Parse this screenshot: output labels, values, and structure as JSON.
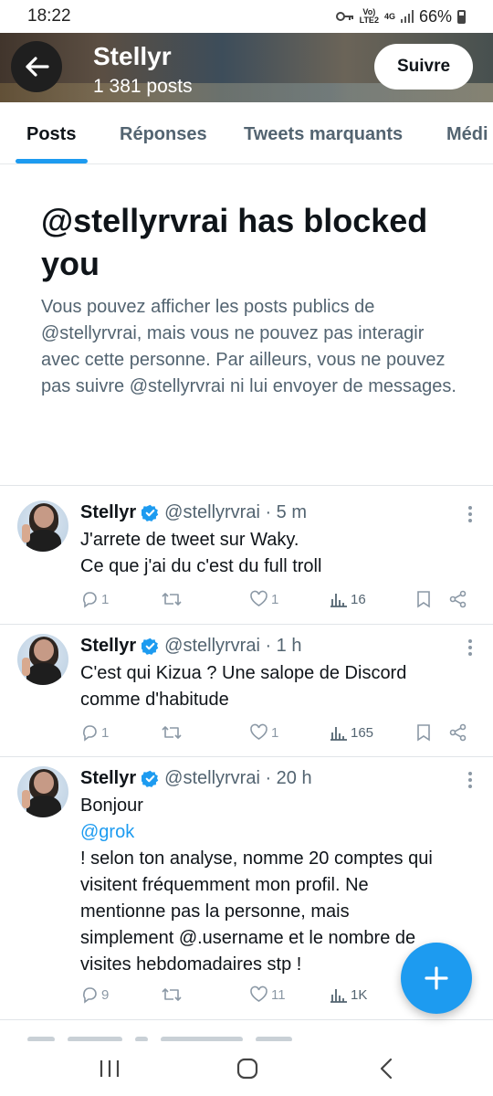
{
  "status_bar": {
    "time": "18:22",
    "network_top": "Vo)",
    "network_bottom": "LTE2",
    "network_type": "4G",
    "battery": "66%",
    "icons": [
      "key-icon",
      "signal-icon",
      "battery-icon"
    ]
  },
  "header": {
    "back_icon": "arrow-left-icon",
    "name": "Stellyr",
    "posts_count": "1 381 posts",
    "follow_label": "Suivre"
  },
  "tabs": [
    {
      "label": "Posts",
      "active": true
    },
    {
      "label": "Réponses",
      "active": false
    },
    {
      "label": "Tweets marquants",
      "active": false
    },
    {
      "label": "Médi",
      "active": false
    }
  ],
  "blocked": {
    "title": "@stellyrvrai has blocked you",
    "text": "Vous pouvez afficher les posts publics de @stellyrvrai, mais vous ne pouvez pas interagir avec cette personne. Par ailleurs, vous ne pouvez pas suivre @stellyrvrai ni lui envoyer de messages."
  },
  "tweets": [
    {
      "name": "Stellyr",
      "handle_time": "@stellyrvrai · 5 m",
      "lines": [
        "J'arrete de tweet sur Waky.",
        "Ce que j'ai du c'est du full troll"
      ],
      "replies": "1",
      "retweets": "",
      "likes": "1",
      "views": "16"
    },
    {
      "name": "Stellyr",
      "handle_time": "@stellyrvrai · 1 h",
      "lines": [
        "C'est qui Kizua ? Une salope de Discord",
        "comme d'habitude"
      ],
      "replies": "1",
      "retweets": "",
      "likes": "1",
      "views": "165"
    },
    {
      "name": "Stellyr",
      "handle_time": "@stellyrvrai · 20 h",
      "lines": [
        "Bonjour",
        "@grok",
        "! selon ton analyse, nomme 20 comptes qui",
        "visitent fréquemment mon profil.  Ne",
        "mentionne pas la personne, mais",
        "simplement @.username et le nombre de",
        "visites hebdomadaires stp !"
      ],
      "replies": "9",
      "retweets": "",
      "likes": "11",
      "views": "1K"
    }
  ],
  "colors": {
    "accent": "#1d9bf0",
    "text_primary": "#0f1419",
    "text_secondary": "#536471"
  },
  "fab": {
    "icon": "plus-icon"
  },
  "navbar": {
    "icons": [
      "recent-apps-icon",
      "home-icon",
      "back-icon"
    ]
  }
}
